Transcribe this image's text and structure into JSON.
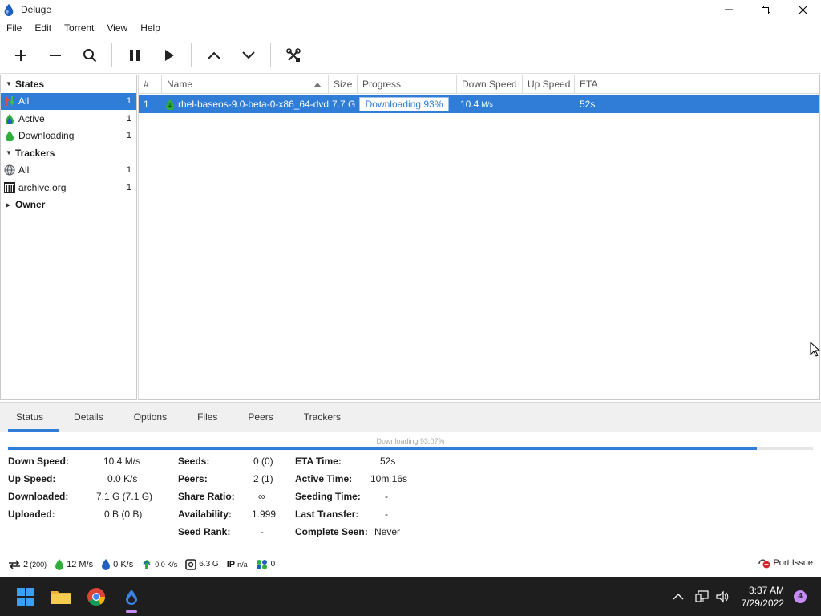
{
  "window": {
    "title": "Deluge"
  },
  "menu": [
    "File",
    "Edit",
    "Torrent",
    "View",
    "Help"
  ],
  "toolbar": {
    "buttons": [
      "add-torrent",
      "remove-torrent",
      "search",
      "pause",
      "resume",
      "move-up",
      "move-down",
      "preferences"
    ]
  },
  "sidebar": {
    "states": {
      "label": "States",
      "items": [
        {
          "label": "All",
          "count": "1"
        },
        {
          "label": "Active",
          "count": "1"
        },
        {
          "label": "Downloading",
          "count": "1"
        }
      ]
    },
    "trackers": {
      "label": "Trackers",
      "items": [
        {
          "label": "All",
          "count": "1"
        },
        {
          "label": "archive.org",
          "count": "1"
        }
      ]
    },
    "owner": {
      "label": "Owner"
    }
  },
  "torrent_list": {
    "columns": [
      "#",
      "Name",
      "Size",
      "Progress",
      "Down Speed",
      "Up Speed",
      "ETA"
    ],
    "rows": [
      {
        "index": "1",
        "name": "rhel-baseos-9.0-beta-0-x86_64-dvd",
        "size": "7.7 G",
        "progress_text": "Downloading 93%",
        "progress": 93,
        "down_speed": "10.4",
        "down_unit": "M/s",
        "up_speed": "",
        "eta": "52s"
      }
    ]
  },
  "tabs": [
    "Status",
    "Details",
    "Options",
    "Files",
    "Peers",
    "Trackers"
  ],
  "status": {
    "progress_label": "Downloading 93.07%",
    "progress": 93.07,
    "col1": [
      {
        "label": "Down Speed:",
        "value": "10.4 M/s"
      },
      {
        "label": "Up Speed:",
        "value": "0.0 K/s"
      },
      {
        "label": "Downloaded:",
        "value": "7.1 G (7.1 G)"
      },
      {
        "label": "Uploaded:",
        "value": "0 B (0 B)"
      }
    ],
    "col2": [
      {
        "label": "Seeds:",
        "value": "0 (0)"
      },
      {
        "label": "Peers:",
        "value": "2 (1)"
      },
      {
        "label": "Share Ratio:",
        "value": "∞"
      },
      {
        "label": "Availability:",
        "value": "1.999"
      },
      {
        "label": "Seed Rank:",
        "value": "-"
      }
    ],
    "col3": [
      {
        "label": "ETA Time:",
        "value": "52s"
      },
      {
        "label": "Active Time:",
        "value": "10m 16s"
      },
      {
        "label": "Seeding Time:",
        "value": "-"
      },
      {
        "label": "Last Transfer:",
        "value": "-"
      },
      {
        "label": "Complete Seen:",
        "value": "Never"
      }
    ]
  },
  "statusbar": {
    "connections": "2",
    "connections_limit": "(200)",
    "down": "12 M/s",
    "up": "0 K/s",
    "protocol": "0.0 K/s",
    "disk": "6.3 G",
    "ip_label": "IP",
    "ip": "n/a",
    "dht": "0",
    "port_issue": "Port Issue"
  },
  "taskbar": {
    "time": "3:37 AM",
    "date": "7/29/2022",
    "notifications": "4"
  },
  "colors": {
    "accent": "#2f7dd7",
    "taskbar": "#1e1e1e",
    "deluge_blue": "#1f5fbf",
    "green": "#2fae3a"
  }
}
